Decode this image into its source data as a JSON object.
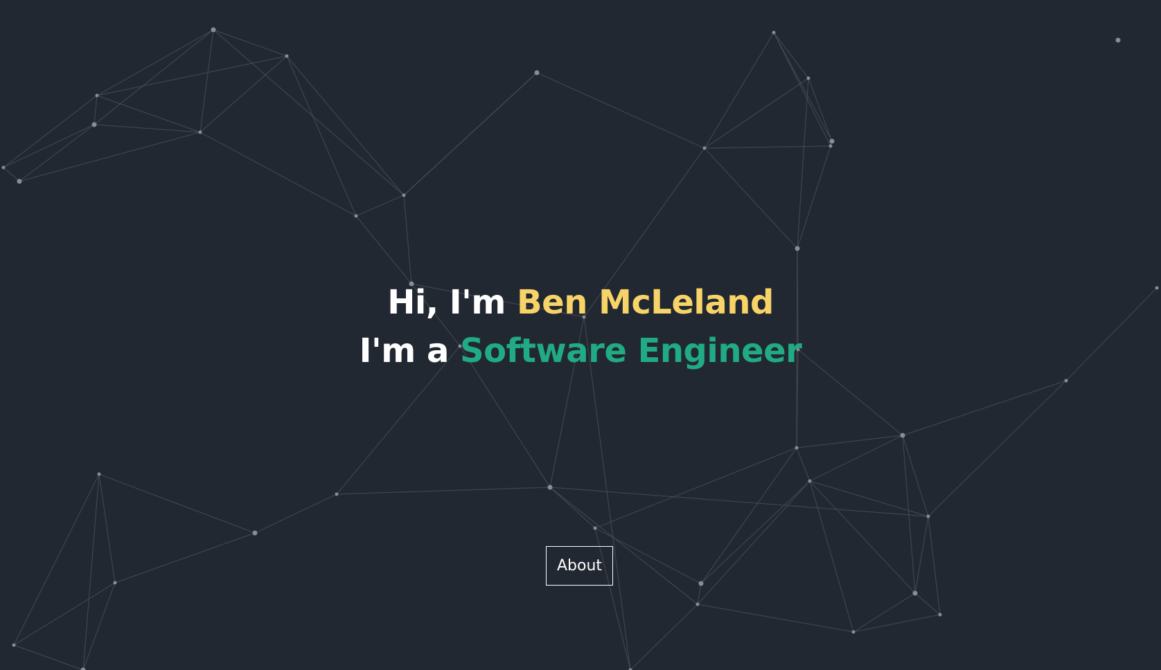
{
  "hero": {
    "greeting_prefix": "Hi, I'm ",
    "name": "Ben McLeland",
    "role_prefix": "I'm a ",
    "role": "Software Engineer"
  },
  "buttons": {
    "about_label": "About"
  },
  "colors": {
    "background": "#222831",
    "name_accent": "#f8d367",
    "role_accent": "#21ab85",
    "text": "#ffffff",
    "network_lines": "#4a4e57",
    "network_nodes": "#8a8d93"
  }
}
